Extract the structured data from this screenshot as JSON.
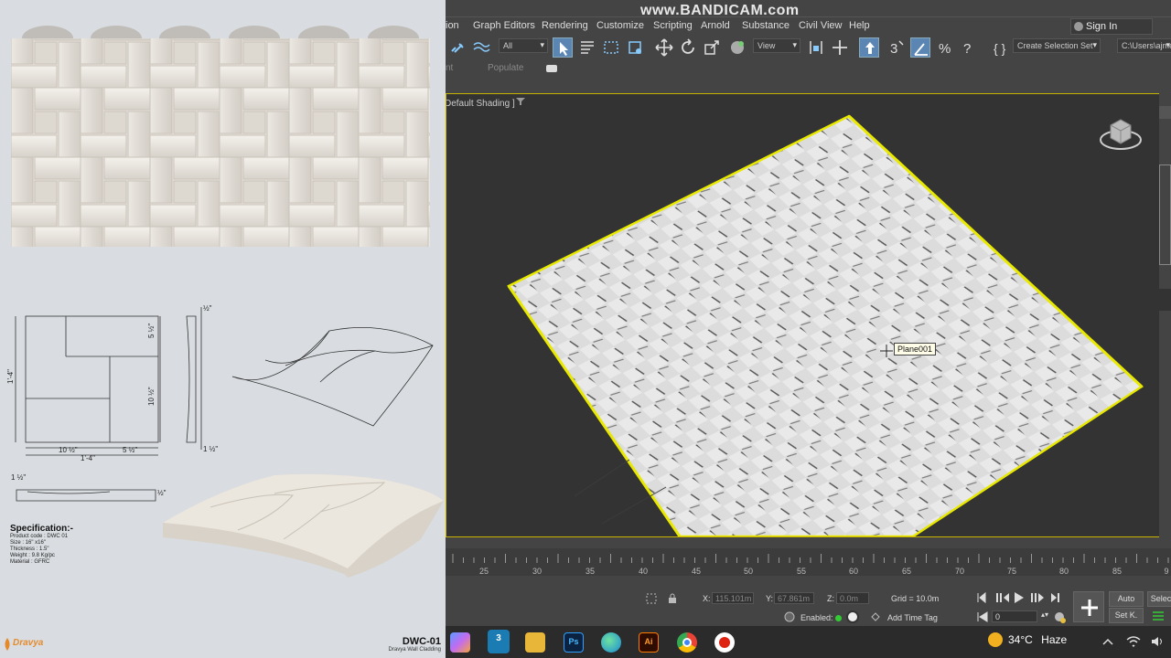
{
  "watermark": "www.BANDICAM.com",
  "reference": {
    "dims": {
      "top_right_1": "5 ½\"",
      "top_right_2": "10 ½\"",
      "left": "1'-4\"",
      "bottom_1": "10 ½\"",
      "bottom_2": "5 ½\"",
      "bottom_total": "1'-4\"",
      "side_top": "½\"",
      "side_bottom": "1 ½\"",
      "section_left": "1 ½\"",
      "section_right": "½\""
    },
    "spec_title": "Specification:-",
    "spec_lines": [
      "Product code : DWC 01",
      "Size : 16\" x16\"",
      "Thickness : 1.5\"",
      "Weight : 9.8 Kg/pc",
      "Material : GFRC"
    ],
    "brand_name": "Dravya",
    "code": "DWC-01",
    "description": "Dravya Wall Cladding"
  },
  "menu": [
    "ion",
    "Graph Editors",
    "Rendering",
    "Customize",
    "Scripting",
    "Arnold",
    "Substance",
    "Civil View",
    "Help"
  ],
  "sign_in": "Sign In",
  "toolbar": {
    "filter": "All",
    "ref_coord": "View",
    "selection_set": "Create Selection Set",
    "path": "C:\\Users\\ajme"
  },
  "ribbon": [
    "nt",
    "Populate"
  ],
  "viewport": {
    "label": "Default Shading ]",
    "tooltip": "Plane001"
  },
  "timeline": {
    "ticks": [
      "25",
      "30",
      "35",
      "40",
      "45",
      "50",
      "55",
      "60",
      "65",
      "70",
      "75",
      "80",
      "85",
      "9"
    ]
  },
  "status": {
    "x_label": "X:",
    "x_value": "115.101m",
    "y_label": "Y:",
    "y_value": "67.861m",
    "z_label": "Z:",
    "z_value": "0.0m",
    "grid": "Grid = 10.0m",
    "enabled": "Enabled:",
    "add_time_tag": "Add Time Tag",
    "frame": "0",
    "auto": "Auto",
    "set_key": "Set K.",
    "select": "Selec"
  },
  "taskbar": {
    "apps": [
      "copilot",
      "3ds-max",
      "file-explorer",
      "photoshop",
      "edge",
      "illustrator",
      "chrome",
      "bandicam"
    ],
    "app_labels": {
      "max": "3",
      "ps": "Ps",
      "ai": "Ai"
    },
    "temperature": "34°C",
    "weather": "Haze"
  },
  "colors": {
    "selection_yellow": "#e8e800",
    "viewport_border": "#c8b400",
    "active_tool": "#5b86b4",
    "brand": "#e58a2b"
  }
}
